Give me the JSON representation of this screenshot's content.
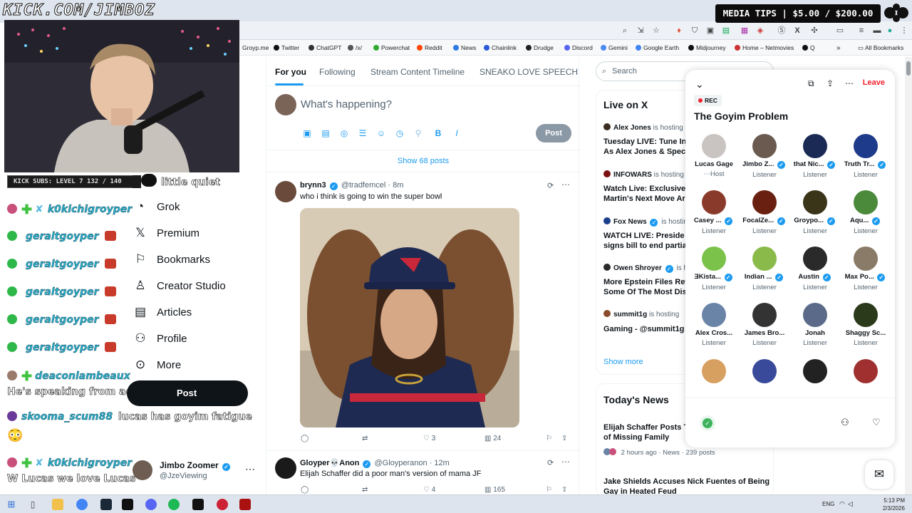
{
  "overlay": {
    "kick_url": "KICK.COM/JIMBOZ",
    "media_tips": "MEDIA TIPS | $5.00 / $200.00",
    "kick_subs": "KICK SUBS: LEVEL 7 132 / 140"
  },
  "chat": [
    {
      "name": "",
      "msg": "little quiet"
    },
    {
      "name": "k0kichigroyper",
      "msg": ""
    },
    {
      "name": "geraltgoyper",
      "msg": ""
    },
    {
      "name": "geraltgoyper",
      "msg": ""
    },
    {
      "name": "geraltgoyper",
      "msg": ""
    },
    {
      "name": "geraltgoyper",
      "msg": ""
    },
    {
      "name": "geraltgoyper",
      "msg": ""
    },
    {
      "name": "deaconlambeaux",
      "msg": "He's speaking from across the room"
    },
    {
      "name": "skooma_scum88",
      "msg": "lucas has goyim fatigue"
    },
    {
      "name": "k0kichigroyper",
      "msg": "W Lucas we love Lucas"
    }
  ],
  "bookmarks": [
    "Groyp.me",
    "Twitter",
    "ChatGPT",
    "/x/",
    "Powerchat",
    "Reddit",
    "News",
    "Chainlink",
    "Drudge",
    "Discord",
    "Gemini",
    "Google Earth",
    "Midjourney",
    "Home – Netmovies",
    "Q",
    "All Bookmarks"
  ],
  "nav": {
    "items": [
      "Grok",
      "Premium",
      "Bookmarks",
      "Creator Studio",
      "Articles",
      "Profile",
      "More"
    ],
    "post_label": "Post",
    "account_name": "Jimbo Zoomer",
    "account_handle": "@JzeViewing"
  },
  "timeline": {
    "tabs": [
      "For you",
      "Following",
      "Stream Content Timeline",
      "SNEAKO LOVE SPEECH"
    ],
    "compose_placeholder": "What's happening?",
    "compose_post": "Post",
    "show_posts": "Show 68 posts",
    "tweets": [
      {
        "name": "brynn3",
        "handle": "@tradfemcel · 8m",
        "text": "who i think is going to win the super bowl",
        "replies": "",
        "retweets": "",
        "likes": "3",
        "views": "24"
      },
      {
        "name": "Gloyper💀Anon",
        "handle": "@Gloyperanon · 12m",
        "text": "Elijah Schaffer did a poor man's version of mama JF",
        "replies": "",
        "retweets": "",
        "likes": "4",
        "views": "165"
      }
    ]
  },
  "sidebar": {
    "search_placeholder": "Search",
    "live_title": "Live on X",
    "hosting_suffix": "is hosting",
    "live": [
      {
        "host": "Alex Jones",
        "title": "Tuesday LIVE: Tune In As Alex Jones & Speci",
        "color": "#3b2c22"
      },
      {
        "host": "INFOWARS",
        "title": "Watch Live: Exclusive: Martin's Next Move Ar",
        "color": "#7a1010"
      },
      {
        "host": "Fox News",
        "title": "WATCH LIVE: Preside signs bill to end partial",
        "color": "#1c3f8c"
      },
      {
        "host": "Owen Shroyer",
        "title": "More Epstein Files Rev Some Of The Most Dis",
        "color": "#2a2a2a"
      },
      {
        "host": "summit1g",
        "title": "Gaming - @summit1g",
        "color": "#8a4c2a"
      }
    ],
    "show_more": "Show more",
    "news_title": "Today's News",
    "news": [
      {
        "title": "Elijah Schaffer Posts T of Missing Family",
        "meta": "2 hours ago · News · 239 posts"
      },
      {
        "title": "Jake Shields Accuses Nick Fuentes of Being Gay in Heated Feud",
        "meta": ""
      }
    ]
  },
  "space": {
    "leave": "Leave",
    "rec": "REC",
    "title": "The Goyim Problem",
    "participants": [
      {
        "name": "Lucas Gage",
        "role": "Host",
        "verified": false,
        "color": "#c9c4c2"
      },
      {
        "name": "Jimbo Z...",
        "role": "Listener",
        "verified": true,
        "color": "#6a5a50"
      },
      {
        "name": "that Nic...",
        "role": "Listener",
        "verified": true,
        "color": "#1a2a55"
      },
      {
        "name": "Truth Tr...",
        "role": "Listener",
        "verified": true,
        "color": "#1e3a8a"
      },
      {
        "name": "Casey ...",
        "role": "Listener",
        "verified": true,
        "color": "#8a3a2a"
      },
      {
        "name": "FocalZe...",
        "role": "Listener",
        "verified": true,
        "color": "#6a2010"
      },
      {
        "name": "Groypo...",
        "role": "Listener",
        "verified": true,
        "color": "#3a3418"
      },
      {
        "name": "Aqu...",
        "role": "Listener",
        "verified": true,
        "color": "#4a8a3a"
      },
      {
        "name": "ƎKista...",
        "role": "Listener",
        "verified": true,
        "color": "#7bc24a"
      },
      {
        "name": "Indian ...",
        "role": "Listener",
        "verified": true,
        "color": "#8aba4a"
      },
      {
        "name": "Austin",
        "role": "Listener",
        "verified": true,
        "color": "#2a2a2a"
      },
      {
        "name": "Max Po...",
        "role": "Listener",
        "verified": true,
        "color": "#8a7a68"
      },
      {
        "name": "Alex Cros...",
        "role": "Listener",
        "verified": false,
        "color": "#6a84a8"
      },
      {
        "name": "James Bro...",
        "role": "Listener",
        "verified": false,
        "color": "#333333"
      },
      {
        "name": "Jonah",
        "role": "Listener",
        "verified": false,
        "color": "#5a6a88"
      },
      {
        "name": "Shaggy Sc...",
        "role": "Listener",
        "verified": false,
        "color": "#2a3a1a"
      },
      {
        "name": "",
        "role": "",
        "verified": false,
        "color": "#d8a060"
      },
      {
        "name": "",
        "role": "",
        "verified": false,
        "color": "#3a4a9a"
      },
      {
        "name": "",
        "role": "",
        "verified": false,
        "color": "#222222"
      },
      {
        "name": "",
        "role": "",
        "verified": false,
        "color": "#a03030"
      }
    ]
  },
  "taskbar": {
    "lang": "ENG",
    "time": "5:13 PM",
    "date": "2/3/2026"
  }
}
